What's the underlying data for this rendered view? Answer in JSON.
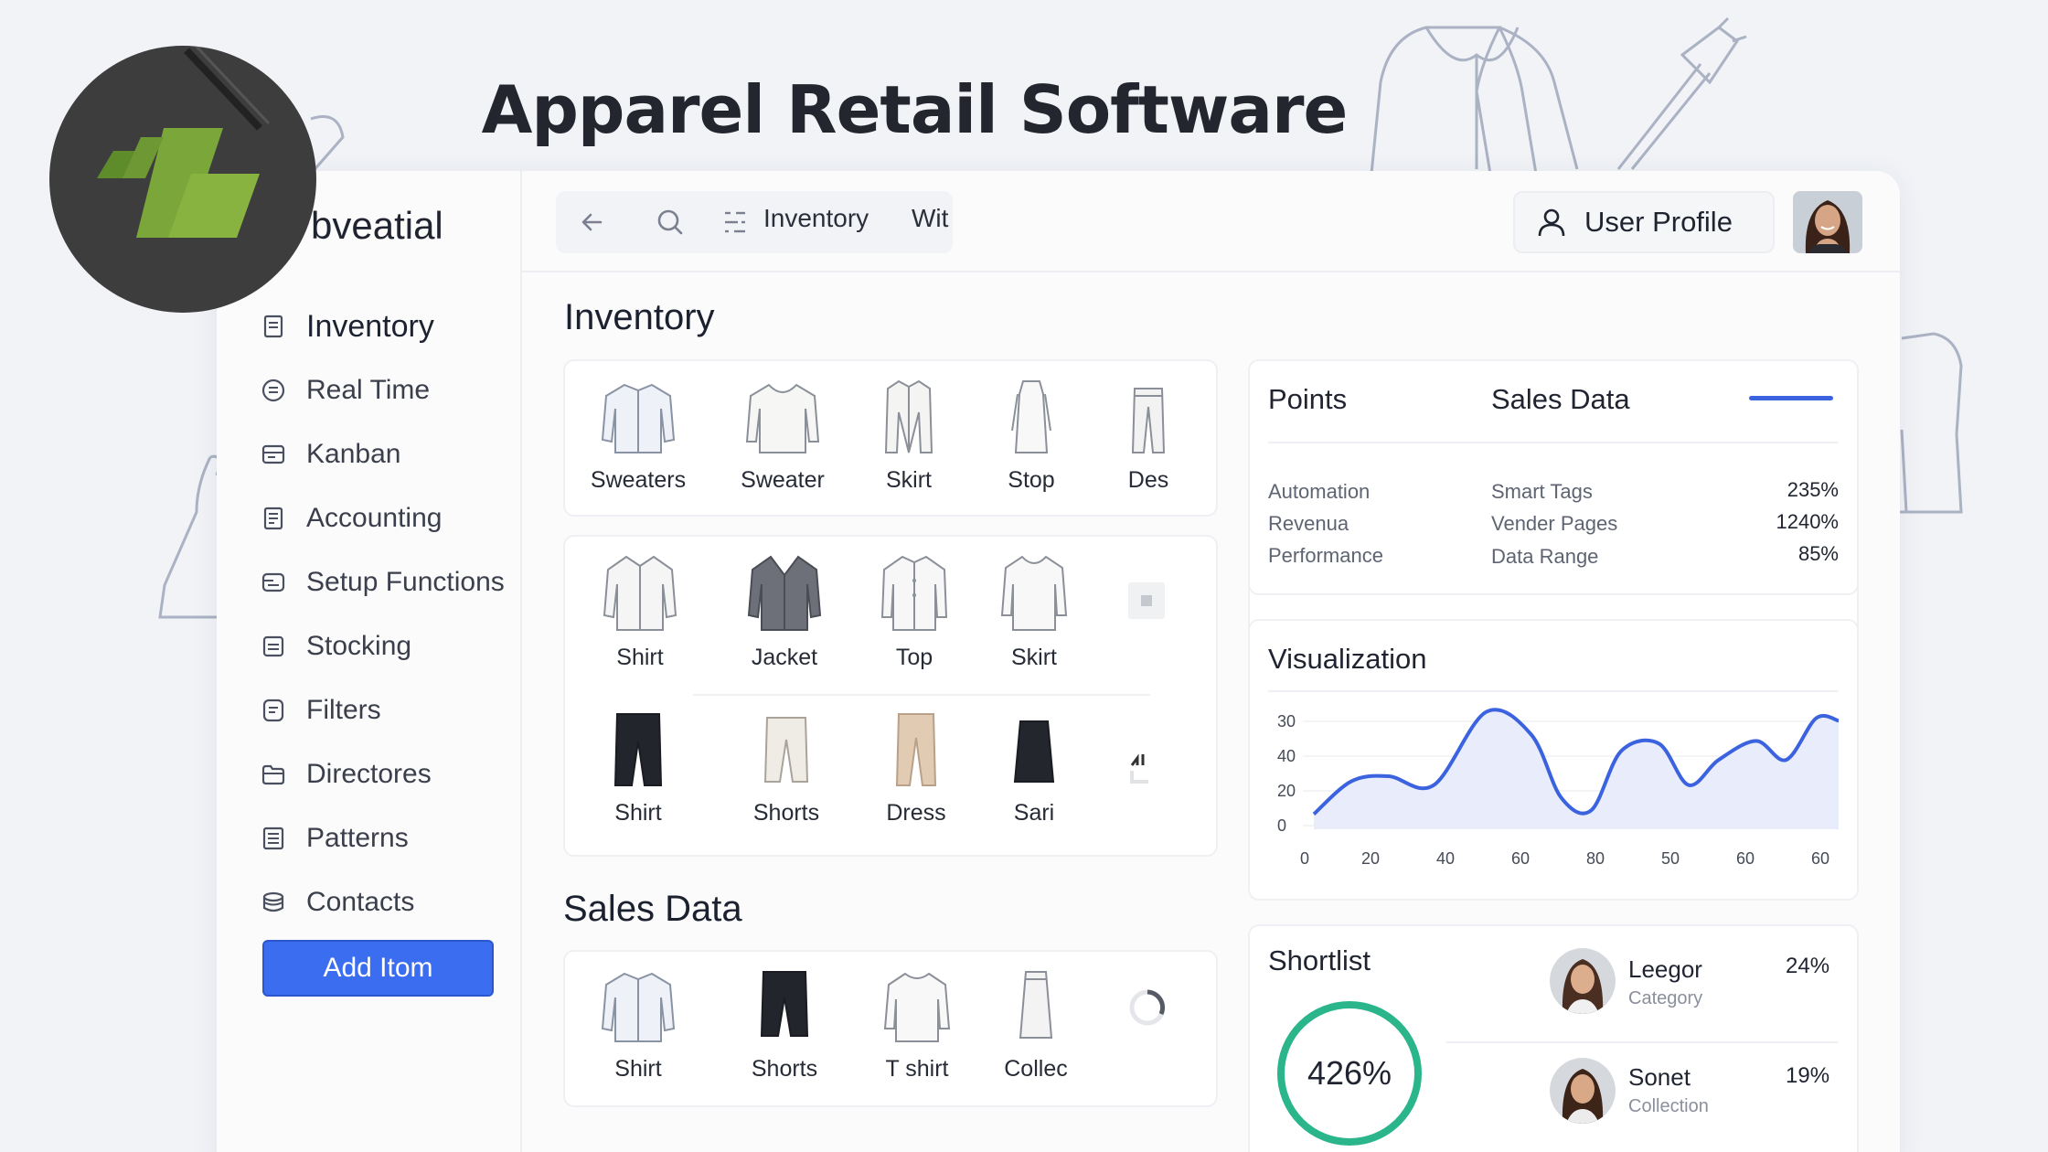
{
  "page_title": "Apparel Retail Software",
  "app": {
    "brand": "bveatial",
    "sidebar": {
      "items": [
        {
          "label": "Inventory",
          "icon": "document-icon"
        },
        {
          "label": "Real Time",
          "icon": "clock-list-icon"
        },
        {
          "label": "Kanban",
          "icon": "board-icon"
        },
        {
          "label": "Accounting",
          "icon": "ledger-icon"
        },
        {
          "label": "Setup Functions",
          "icon": "setup-icon"
        },
        {
          "label": "Stocking",
          "icon": "stack-icon"
        },
        {
          "label": "Filters",
          "icon": "filter-doc-icon"
        },
        {
          "label": "Directores",
          "icon": "folder-icon"
        },
        {
          "label": "Patterns",
          "icon": "pattern-icon"
        },
        {
          "label": "Contacts",
          "icon": "contacts-icon"
        }
      ],
      "add_button": "Add Itom"
    },
    "topbar": {
      "crumb_inventory": "Inventory",
      "crumb_wit": "Wit",
      "user_profile": "User Profile"
    },
    "inventory": {
      "title": "Inventory",
      "row1": [
        "Sweaters",
        "Sweater",
        "Skirt",
        "Stop",
        "Des"
      ],
      "row2": [
        "Shirt",
        "Jacket",
        "Top",
        "Skirt"
      ],
      "row3": [
        "Shirt",
        "Shorts",
        "Dress",
        "Sari"
      ]
    },
    "sales": {
      "title": "Sales Data",
      "items": [
        "Shirt",
        "Shorts",
        "T shirt",
        "Collec"
      ]
    },
    "stats": {
      "col1_head": "Points",
      "col2_head": "Sales Data",
      "rows": [
        {
          "a": "Automation",
          "b": "Smart Tags",
          "v": "235%"
        },
        {
          "a": "Revenua",
          "b": "Vender Pages",
          "v": "1240%"
        },
        {
          "a": "Performance",
          "b": "Data Range",
          "v": "85%"
        }
      ]
    },
    "visualization": {
      "title": "Visualization"
    },
    "shortlist": {
      "title": "Shortlist",
      "ring_value": "426%",
      "entries": [
        {
          "name": "Leegor",
          "sub": "Category",
          "value": "24%"
        },
        {
          "name": "Sonet",
          "sub": "Collection",
          "value": "19%"
        }
      ]
    }
  },
  "chart_data": {
    "type": "area",
    "title": "Visualization",
    "x_tick_labels": [
      "0",
      "20",
      "40",
      "60",
      "80",
      "50",
      "60",
      "60"
    ],
    "y_tick_labels": [
      "30",
      "40",
      "20",
      "0"
    ],
    "series": [
      {
        "x_index": [
          0,
          0.5,
          1.0,
          1.6,
          2.3,
          2.9,
          3.3,
          3.7,
          4.1,
          4.6,
          5.0,
          5.4,
          5.9,
          6.3,
          6.7,
          7.0
        ],
        "y_fraction": [
          0.12,
          0.38,
          0.42,
          0.35,
          0.93,
          0.75,
          0.25,
          0.15,
          0.62,
          0.68,
          0.35,
          0.55,
          0.7,
          0.55,
          0.88,
          0.86
        ]
      }
    ],
    "colors": {
      "line": "#3b63e0",
      "fill": "#e9edfb"
    }
  },
  "colors": {
    "accent": "#3b6df0",
    "ring": "#2bb58a",
    "logo": "#8ab33d"
  }
}
